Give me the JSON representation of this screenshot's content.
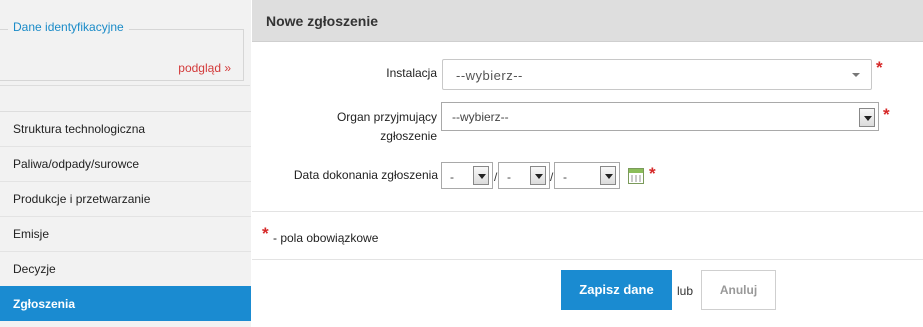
{
  "sidebar": {
    "ident_title": "Dane identyfikacyjne",
    "preview_link": "podgląd »",
    "items": [
      {
        "label": "Struktura technologiczna"
      },
      {
        "label": "Paliwa/odpady/surowce"
      },
      {
        "label": "Produkcje i przetwarzanie"
      },
      {
        "label": "Emisje"
      },
      {
        "label": "Decyzje"
      },
      {
        "label": "Zgłoszenia",
        "active": true
      }
    ]
  },
  "main": {
    "title": "Nowe zgłoszenie",
    "form": {
      "instalacja": {
        "label": "Instalacja",
        "value": "--wybierz--",
        "required": "*"
      },
      "organ": {
        "label_line1": "Organ przyjmujący",
        "label_line2": "zgłoszenie",
        "value": "--wybierz--",
        "required": "*"
      },
      "data": {
        "label": "Data dokonania zgłoszenia",
        "day": "-",
        "month": "-",
        "year": "-",
        "separator": "/",
        "required": "*",
        "calendar_icon": "calendar-icon"
      }
    },
    "legend": {
      "star": "*",
      "text": "- pola obowiązkowe"
    },
    "actions": {
      "save_label": "Zapisz dane",
      "or_text": "lub",
      "cancel_label": "Anuluj"
    }
  },
  "colors": {
    "accent": "#1a8bd1",
    "link_red": "#d33a3a",
    "required_red": "#d62828",
    "header_bg": "#dedede",
    "sidebar_bg": "#f2f2f2"
  }
}
